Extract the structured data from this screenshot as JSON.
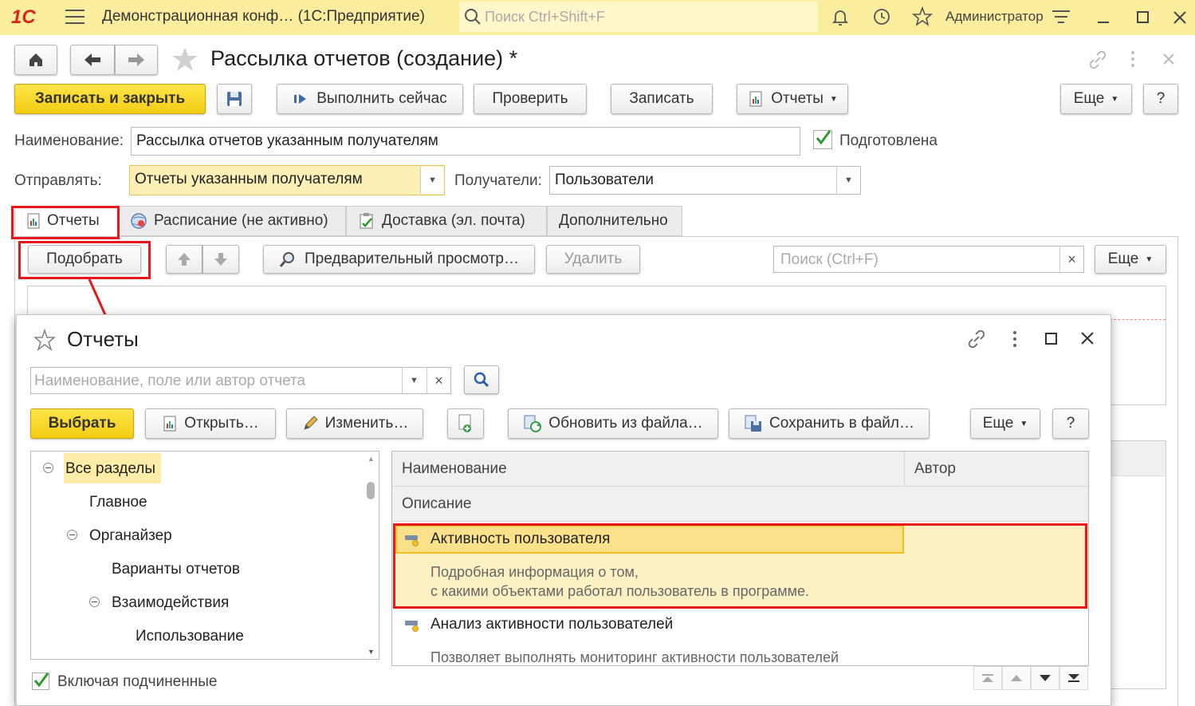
{
  "topbar": {
    "logo": "1С",
    "app_title": "Демонстрационная конф…  (1С:Предприятие)",
    "search_placeholder": "Поиск Ctrl+Shift+F",
    "user": "Администратор"
  },
  "form": {
    "title": "Рассылка отчетов (создание) *",
    "buttons": {
      "write_close": "Записать и закрыть",
      "run_now": "Выполнить сейчас",
      "check": "Проверить",
      "write": "Записать",
      "reports": "Отчеты",
      "more": "Еще",
      "help": "?"
    },
    "name_label": "Наименование:",
    "name_value": "Рассылка отчетов указанным получателям",
    "prepared_label": "Подготовлена",
    "prepared_checked": true,
    "send_label": "Отправлять:",
    "send_value": "Отчеты указанным получателям",
    "recipients_label": "Получатели:",
    "recipients_value": "Пользователи",
    "tabs": [
      {
        "label": "Отчеты",
        "active": true
      },
      {
        "label": "Расписание (не активно)",
        "active": false
      },
      {
        "label": "Доставка (эл. почта)",
        "active": false
      },
      {
        "label": "Дополнительно",
        "active": false
      }
    ],
    "toolbar": {
      "pick": "Подобрать",
      "preview": "Предварительный просмотр…",
      "delete": "Удалить",
      "search_placeholder": "Поиск (Ctrl+F)",
      "clear": "×",
      "more": "Еще"
    }
  },
  "dialog": {
    "title": "Отчеты",
    "search_placeholder": "Наименование, поле или автор отчета",
    "clear": "×",
    "buttons": {
      "select": "Выбрать",
      "open": "Открыть…",
      "edit": "Изменить…",
      "update_from_file": "Обновить из файла…",
      "save_to_file": "Сохранить в файл…",
      "more": "Еще",
      "help": "?"
    },
    "tree": [
      {
        "label": "Все разделы",
        "level": 0,
        "expanded": true,
        "selected": true
      },
      {
        "label": "Главное",
        "level": 1
      },
      {
        "label": "Органайзер",
        "level": 1,
        "expanded": true
      },
      {
        "label": "Варианты отчетов",
        "level": 2
      },
      {
        "label": "Взаимодействия",
        "level": 2,
        "expanded": true
      },
      {
        "label": "Использование",
        "level": 3
      }
    ],
    "include_sub_label": "Включая подчиненные",
    "include_sub_checked": true,
    "grid": {
      "col_name": "Наименование",
      "col_author": "Автор",
      "col_desc": "Описание",
      "rows": [
        {
          "name": "Активность пользователя",
          "desc_line1": "Подробная информация о том,",
          "desc_line2": "с какими объектами работал пользователь в программе."
        },
        {
          "name": "Анализ активности пользователей",
          "desc_line1": "Позволяет выполнять мониторинг активности пользователей",
          "desc_line2": ""
        }
      ]
    }
  },
  "colors": {
    "topbar": "#fbed9e",
    "accent_yellow": "#f3cc12",
    "highlight_red": "#e8161d",
    "selection": "#fdf1c3"
  }
}
